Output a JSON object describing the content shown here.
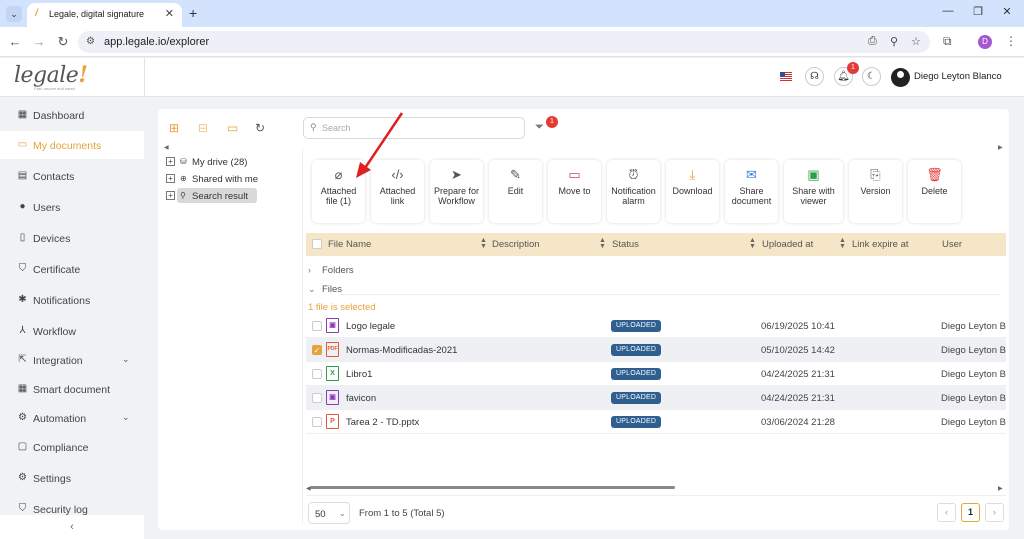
{
  "browser": {
    "tab_title": "Legale, digital signature",
    "url": "app.legale.io/explorer",
    "profile_initial": "D"
  },
  "header": {
    "logo_text": "legale",
    "logo_bang": "!",
    "tagline": "Fast, secure and smart",
    "notification_count": "1",
    "user_name": "Diego Leyton Blanco"
  },
  "sidebar": {
    "items": [
      {
        "label": "Dashboard",
        "icon": "dashboard-icon"
      },
      {
        "label": "My documents",
        "icon": "folder-icon"
      },
      {
        "label": "Contacts",
        "icon": "contacts-icon"
      },
      {
        "label": "Users",
        "icon": "users-icon"
      },
      {
        "label": "Devices",
        "icon": "devices-icon"
      },
      {
        "label": "Certificate",
        "icon": "certificate-icon"
      },
      {
        "label": "Notifications",
        "icon": "bell-icon"
      },
      {
        "label": "Workflow",
        "icon": "workflow-icon"
      },
      {
        "label": "Integration",
        "icon": "integration-icon"
      },
      {
        "label": "Smart document",
        "icon": "smart-document-icon"
      },
      {
        "label": "Automation",
        "icon": "automation-icon"
      },
      {
        "label": "Compliance",
        "icon": "compliance-icon"
      },
      {
        "label": "Settings",
        "icon": "settings-icon"
      },
      {
        "label": "Security log",
        "icon": "security-log-icon"
      }
    ],
    "active": "My documents"
  },
  "explorer": {
    "search_placeholder": "Search",
    "filter_count": "1",
    "tree": [
      {
        "label": "My drive (28)"
      },
      {
        "label": "Shared with me"
      },
      {
        "label": "Search result"
      }
    ],
    "actions": [
      {
        "label": "Attached file (1)",
        "icon": "paperclip-icon"
      },
      {
        "label": "Attached link",
        "icon": "link-icon"
      },
      {
        "label": "Prepare for Workflow",
        "icon": "send-icon"
      },
      {
        "label": "Edit",
        "icon": "edit-icon"
      },
      {
        "label": "Move to",
        "icon": "move-folder-icon"
      },
      {
        "label": "Notification alarm",
        "icon": "alarm-icon"
      },
      {
        "label": "Download",
        "icon": "download-icon"
      },
      {
        "label": "Share document",
        "icon": "mail-icon"
      },
      {
        "label": "Share with viewer",
        "icon": "share-viewer-icon"
      },
      {
        "label": "Version",
        "icon": "version-icon"
      },
      {
        "label": "Delete",
        "icon": "trash-icon"
      }
    ],
    "columns": {
      "file_name": "File Name",
      "description": "Description",
      "status": "Status",
      "uploaded_at": "Uploaded at",
      "link_expire": "Link expire at",
      "user": "User"
    },
    "groups": {
      "folders": "Folders",
      "files": "Files"
    },
    "selection_info": "1 file is selected",
    "rows": [
      {
        "name": "Logo legale",
        "type": "image",
        "status": "UPLOADED",
        "uploaded": "06/19/2025 10:41",
        "user": "Diego Leyton Blanco",
        "checked": false
      },
      {
        "name": "Normas-Modificadas-2021",
        "type": "pdf",
        "status": "UPLOADED",
        "uploaded": "05/10/2025 14:42",
        "user": "Diego Leyton Blanco",
        "checked": true
      },
      {
        "name": "Libro1",
        "type": "excel",
        "status": "UPLOADED",
        "uploaded": "04/24/2025 21:31",
        "user": "Diego Leyton Blanco",
        "checked": false
      },
      {
        "name": "favicon",
        "type": "image",
        "status": "UPLOADED",
        "uploaded": "04/24/2025 21:31",
        "user": "Diego Leyton Blanco",
        "checked": false
      },
      {
        "name": "Tarea 2 - TD.pptx",
        "type": "powerpoint",
        "status": "UPLOADED",
        "uploaded": "03/06/2024 21:28",
        "user": "Diego Leyton Blanco",
        "checked": false
      }
    ],
    "page_size": "50",
    "range_text": "From 1 to 5 (Total 5)",
    "current_page": "1"
  },
  "colors": {
    "accent": "#e6a23c",
    "status_badge": "#2f5f8f",
    "badge_red": "#e53935",
    "header_row": "#f6e6c8"
  }
}
